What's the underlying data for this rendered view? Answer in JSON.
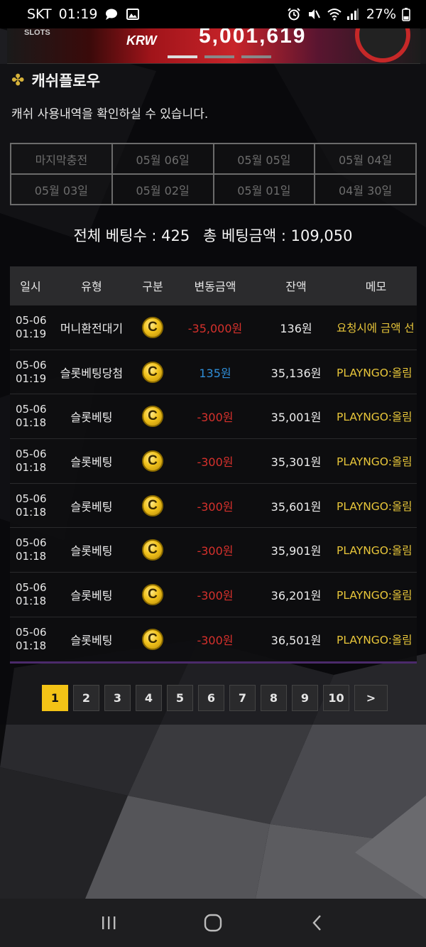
{
  "status_bar": {
    "carrier": "SKT",
    "time": "01:19",
    "battery": "27%"
  },
  "banner": {
    "slots_label": "SLOTS",
    "currency": "KRW",
    "amount": "5,001,619"
  },
  "section": {
    "title": "캐쉬플로우",
    "subtitle": "캐쉬 사용내역을 확인하실 수 있습니다."
  },
  "date_tabs": [
    "마지막충전",
    "05월 06일",
    "05월 05일",
    "05월 04일",
    "05월 03일",
    "05월 02일",
    "05월 01일",
    "04월 30일"
  ],
  "summary": {
    "total_bets": "전체 베팅수 : 425",
    "total_amount": "총 베팅금액 : 109,050"
  },
  "table": {
    "headers": [
      "일시",
      "유형",
      "구분",
      "변동금액",
      "잔액",
      "메모"
    ],
    "coin_symbol": "C",
    "rows": [
      {
        "date": "05-06",
        "time": "01:19",
        "type": "머니환전대기",
        "amount": "-35,000원",
        "sign": "neg",
        "balance": "136원",
        "memo": "요청시에 금액 선"
      },
      {
        "date": "05-06",
        "time": "01:19",
        "type": "슬롯베팅당첨",
        "amount": "135원",
        "sign": "pos",
        "balance": "35,136원",
        "memo": "PLAYNGO:올림"
      },
      {
        "date": "05-06",
        "time": "01:18",
        "type": "슬롯베팅",
        "amount": "-300원",
        "sign": "neg",
        "balance": "35,001원",
        "memo": "PLAYNGO:올림"
      },
      {
        "date": "05-06",
        "time": "01:18",
        "type": "슬롯베팅",
        "amount": "-300원",
        "sign": "neg",
        "balance": "35,301원",
        "memo": "PLAYNGO:올림"
      },
      {
        "date": "05-06",
        "time": "01:18",
        "type": "슬롯베팅",
        "amount": "-300원",
        "sign": "neg",
        "balance": "35,601원",
        "memo": "PLAYNGO:올림"
      },
      {
        "date": "05-06",
        "time": "01:18",
        "type": "슬롯베팅",
        "amount": "-300원",
        "sign": "neg",
        "balance": "35,901원",
        "memo": "PLAYNGO:올림"
      },
      {
        "date": "05-06",
        "time": "01:18",
        "type": "슬롯베팅",
        "amount": "-300원",
        "sign": "neg",
        "balance": "36,201원",
        "memo": "PLAYNGO:올림"
      },
      {
        "date": "05-06",
        "time": "01:18",
        "type": "슬롯베팅",
        "amount": "-300원",
        "sign": "neg",
        "balance": "36,501원",
        "memo": "PLAYNGO:올림"
      }
    ]
  },
  "pagination": {
    "pages": [
      "1",
      "2",
      "3",
      "4",
      "5",
      "6",
      "7",
      "8",
      "9",
      "10"
    ],
    "active": "1",
    "next_label": ">"
  },
  "colors": {
    "accent_yellow": "#f3c316",
    "negative": "#d6312c",
    "positive": "#2f8ed8",
    "memo": "#e8c63a"
  }
}
